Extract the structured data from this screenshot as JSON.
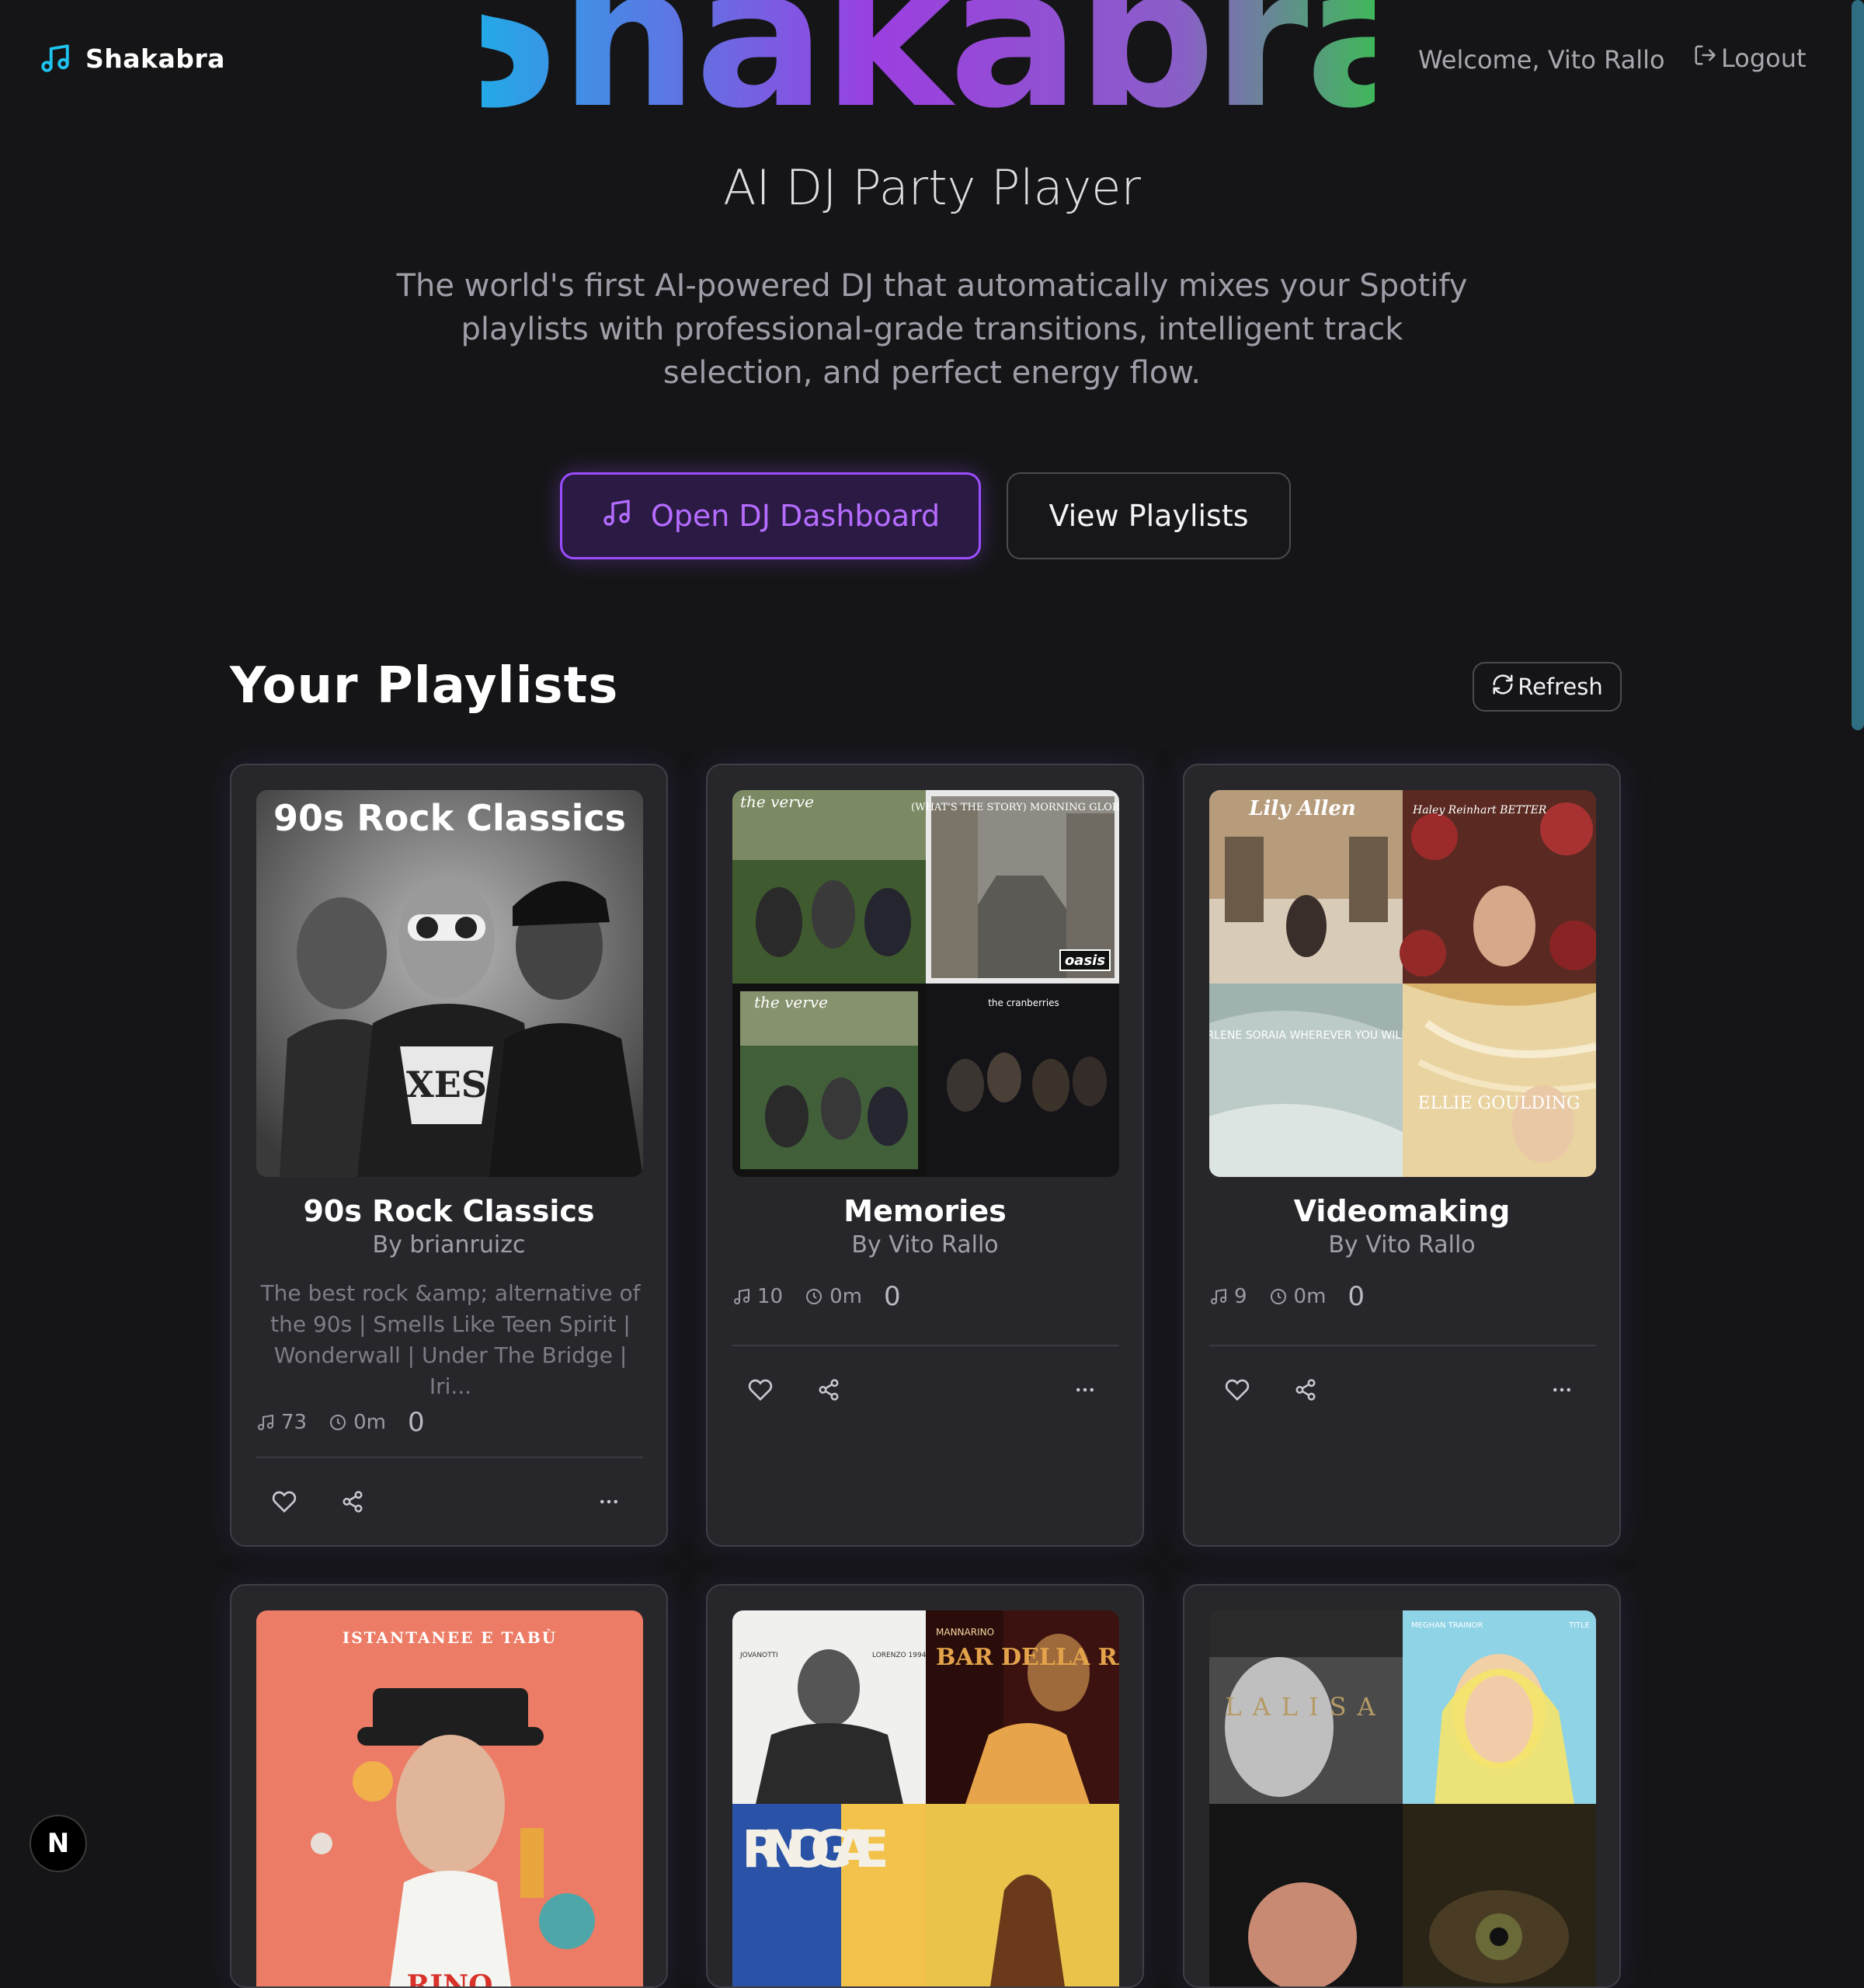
{
  "header": {
    "brand_name": "Shakabra",
    "hero_wordmark": "Shakabra",
    "welcome_text": "Welcome, Vito Rallo",
    "logout_label": "Logout"
  },
  "hero": {
    "subtitle": "AI DJ Party Player",
    "tagline": "The world's first AI-powered DJ that automatically mixes your Spotify playlists with professional-grade transitions, intelligent track selection, and perfect energy flow.",
    "primary_cta": "Open DJ Dashboard",
    "secondary_cta": "View Playlists"
  },
  "playlists_section": {
    "title": "Your Playlists",
    "refresh_label": "Refresh"
  },
  "playlists": [
    {
      "title": "90s Rock Classics",
      "owner": "By brianruizc",
      "description": "The best rock &amp; alternative of the 90s | Smells Like Teen Spirit | Wonderwall | Under The Bridge | Iri...",
      "tracks": "73",
      "duration": "0m",
      "extra": "0",
      "cover_text": "90s Rock Classics"
    },
    {
      "title": "Memories",
      "owner": "By Vito Rallo",
      "description": "",
      "tracks": "10",
      "duration": "0m",
      "extra": "0",
      "cover_texts": [
        "the verve",
        "(WHAT'S THE STORY) MORNING GLORY ?",
        "oasis",
        "the verve",
        "the cranberries"
      ]
    },
    {
      "title": "Videomaking",
      "owner": "By Vito Rallo",
      "description": "",
      "tracks": "9",
      "duration": "0m",
      "extra": "0",
      "cover_texts": [
        "Lily Allen",
        "Haley Reinhart BETTER",
        "CHARLENE SORAIA WHEREVER YOU WILL GO",
        "ELLIE GOULDING"
      ]
    },
    {
      "cover_text": "ISTANTANEE E TABÙ",
      "cover_text_2": "RINO"
    },
    {
      "cover_texts": [
        "JOVANOTTI",
        "LORENZO 1994",
        "MANNARINO",
        "BAR DELLA RABBIA",
        "RINO GAE"
      ]
    },
    {
      "cover_texts": [
        "LALISA",
        "MEGHAN TRAINOR",
        "TITLE"
      ]
    }
  ],
  "dev_badge": "N",
  "colors": {
    "background": "#151517",
    "card": "#27272b",
    "accent_purple": "#9b4dff",
    "accent_cyan": "#1fb6e6"
  }
}
